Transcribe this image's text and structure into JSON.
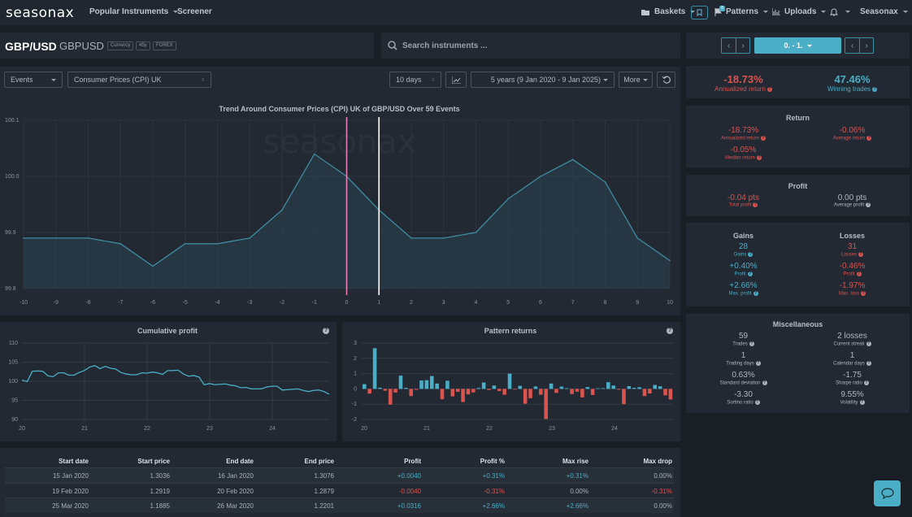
{
  "app": {
    "logo": "seasonax"
  },
  "topnav": {
    "items": [
      {
        "label": "Popular Instruments",
        "dropdown": true
      },
      {
        "label": "Screener",
        "dropdown": false
      }
    ],
    "right_items": [
      {
        "label": "Baskets",
        "icon": "folder-icon",
        "dropdown": true
      },
      {
        "label": "Patterns",
        "icon": "flag-icon",
        "dropdown": true,
        "badge": "8"
      },
      {
        "label": "Uploads",
        "icon": "bar-chart-icon",
        "dropdown": true
      },
      {
        "label": "Seasonax",
        "dropdown": true
      }
    ]
  },
  "instrument": {
    "name": "GBP/USD",
    "symbol": "GBPUSD",
    "tags": [
      "Currency",
      "45y",
      "FOREX"
    ]
  },
  "search": {
    "placeholder": "Search instruments ..."
  },
  "controls": {
    "mode": "Events",
    "event": "Consumer Prices (CPI) UK",
    "days": "10 days",
    "range": "5 years (9 Jan 2020 - 9 Jan 2025)",
    "more": "More"
  },
  "period_selector": {
    "label": "0. - 1."
  },
  "headline": {
    "annualized_return": {
      "value": "-18.73%",
      "label": "Annualized return"
    },
    "winning_trades": {
      "value": "47.46%",
      "label": "Winning trades"
    }
  },
  "return_card": {
    "title": "Return",
    "items": [
      {
        "value": "-18.73%",
        "label": "Annualized return"
      },
      {
        "value": "-0.06%",
        "label": "Average return"
      },
      {
        "value": "-0.05%",
        "label": "Median return"
      }
    ]
  },
  "profit_card": {
    "title": "Profit",
    "items": [
      {
        "value": "-0.04 pts",
        "label": "Total profit"
      },
      {
        "value": "0.00 pts",
        "label": "Average profit"
      }
    ]
  },
  "gains_losses_card": {
    "gains_title": "Gains",
    "losses_title": "Losses",
    "gains": [
      {
        "value": "28",
        "label": "Gains"
      },
      {
        "value": "+0.40%",
        "label": "Profit"
      },
      {
        "value": "+2.66%",
        "label": "Max. profit"
      }
    ],
    "losses": [
      {
        "value": "31",
        "label": "Losses"
      },
      {
        "value": "-0.46%",
        "label": "Profit"
      },
      {
        "value": "-1.97%",
        "label": "Max. loss"
      }
    ]
  },
  "misc_card": {
    "title": "Miscellaneous",
    "items": [
      {
        "value": "59",
        "label": "Trades"
      },
      {
        "value": "2 losses",
        "label": "Current streak"
      },
      {
        "value": "1",
        "label": "Trading days"
      },
      {
        "value": "1",
        "label": "Calendar days"
      },
      {
        "value": "0.63%",
        "label": "Standard deviation"
      },
      {
        "value": "-1.75",
        "label": "Sharpe ratio"
      },
      {
        "value": "-3.30",
        "label": "Sortino ratio"
      },
      {
        "value": "9.55%",
        "label": "Volatility"
      }
    ]
  },
  "chart_data": [
    {
      "type": "area",
      "title": "Trend Around Consumer Prices (CPI) UK of GBP/USD Over 59 Events",
      "watermark": "seasonax",
      "x": [
        -10,
        -9,
        -8,
        -7,
        -6,
        -5,
        -4,
        -3,
        -2,
        -1,
        0,
        1,
        2,
        3,
        4,
        5,
        6,
        7,
        8,
        9,
        10
      ],
      "values": [
        99.89,
        99.89,
        99.89,
        99.88,
        99.84,
        99.88,
        99.88,
        99.89,
        99.94,
        100.04,
        100.0,
        99.94,
        99.89,
        99.89,
        99.9,
        99.96,
        100.0,
        100.03,
        99.99,
        99.89,
        99.85
      ],
      "ylim": [
        99.8,
        100.1
      ],
      "yticks": [
        99.8,
        99.9,
        100.0,
        100.1
      ],
      "ytick_labels": [
        "99.8",
        "99.9",
        "100.0",
        "100.1"
      ],
      "markers": [
        {
          "x": 0,
          "color": "#e87fb8"
        },
        {
          "x": 1,
          "color": "#ffffff"
        }
      ],
      "grid": true
    },
    {
      "type": "line",
      "title": "Cumulative profit",
      "x_ticks": [
        "20",
        "21",
        "22",
        "23",
        "24"
      ],
      "ylim": [
        90,
        110
      ],
      "yticks": [
        90,
        95,
        100,
        105,
        110
      ],
      "values": [
        100.3,
        99.9,
        102.6,
        102.7,
        102.6,
        101.4,
        101.2,
        102.2,
        102.2,
        101.6,
        101.6,
        102.3,
        102.8,
        103.7,
        104.1,
        103.3,
        103.9,
        103.4,
        103.2,
        102.3,
        101.9,
        101.7,
        101.7,
        102.2,
        102.1,
        102.4,
        102.2,
        101.8,
        102.8,
        102.8,
        102.9,
        101.9,
        101.3,
        101.5,
        101.1,
        99.1,
        99.4,
        99.1,
        99.2,
        99.3,
        99.0,
        98.8,
        98.3,
        98.4,
        98.0,
        98.0,
        98.0,
        98.5,
        98.7,
        98.7,
        97.7,
        97.8,
        97.9,
        98.0,
        97.6,
        97.3,
        97.6,
        97.7,
        97.3,
        96.6
      ]
    },
    {
      "type": "bar",
      "title": "Pattern returns",
      "x_ticks": [
        "20",
        "21",
        "22",
        "23",
        "24"
      ],
      "ylim": [
        -2,
        3
      ],
      "yticks": [
        -2,
        -1,
        0,
        1,
        2,
        3
      ],
      "values": [
        0.31,
        -0.31,
        2.66,
        0.08,
        -0.12,
        -1.03,
        -0.24,
        0.87,
        0.07,
        -0.47,
        -0.06,
        0.55,
        0.57,
        0.84,
        0.35,
        -0.68,
        0.53,
        -0.49,
        -0.19,
        -0.86,
        -0.36,
        -0.23,
        0.06,
        0.42,
        -0.07,
        0.22,
        -0.14,
        -0.38,
        1.0,
        -0.04,
        0.2,
        -0.97,
        -0.61,
        0.16,
        -0.38,
        -1.97,
        0.35,
        -0.26,
        0.15,
        0.04,
        -0.34,
        -0.18,
        -0.56,
        0.12,
        -0.4,
        0.02,
        0.01,
        0.44,
        0.22,
        -0.05,
        -1.0,
        0.18,
        0.07,
        0.11,
        -0.47,
        -0.3,
        0.26,
        0.17,
        -0.42,
        -0.69
      ],
      "colors": {
        "positive": "#4aaec6",
        "negative": "#d9534f"
      }
    }
  ],
  "table": {
    "columns": [
      "Start date",
      "Start price",
      "End date",
      "End price",
      "Profit",
      "Profit %",
      "Max rise",
      "Max drop"
    ],
    "rows": [
      [
        "15 Jan 2020",
        "1.3036",
        "16 Jan 2020",
        "1.3076",
        "+0.0040",
        "+0.31%",
        "+0.31%",
        "0.00%"
      ],
      [
        "19 Feb 2020",
        "1.2919",
        "20 Feb 2020",
        "1.2879",
        "-0.0040",
        "-0.31%",
        "0.00%",
        "-0.31%"
      ],
      [
        "25 Mar 2020",
        "1.1885",
        "26 Mar 2020",
        "1.2201",
        "+0.0316",
        "+2.66%",
        "+2.66%",
        "0.00%"
      ]
    ]
  },
  "colors": {
    "accent": "#4aaec6",
    "negative": "#d9534f",
    "background": "#1a1f26",
    "panel": "#222933"
  }
}
